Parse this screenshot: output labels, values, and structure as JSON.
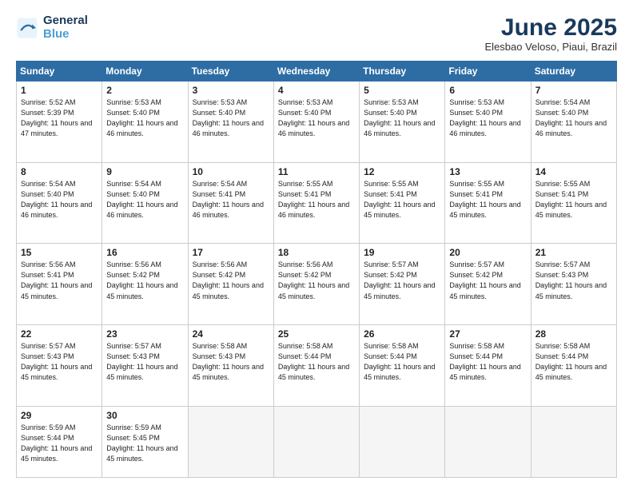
{
  "logo": {
    "line1": "General",
    "line2": "Blue"
  },
  "title": "June 2025",
  "subtitle": "Elesbao Veloso, Piaui, Brazil",
  "days_header": [
    "Sunday",
    "Monday",
    "Tuesday",
    "Wednesday",
    "Thursday",
    "Friday",
    "Saturday"
  ],
  "weeks": [
    [
      {
        "num": "1",
        "rise": "5:52 AM",
        "set": "5:39 PM",
        "hours": "11 hours and 47 minutes."
      },
      {
        "num": "2",
        "rise": "5:53 AM",
        "set": "5:40 PM",
        "hours": "11 hours and 46 minutes."
      },
      {
        "num": "3",
        "rise": "5:53 AM",
        "set": "5:40 PM",
        "hours": "11 hours and 46 minutes."
      },
      {
        "num": "4",
        "rise": "5:53 AM",
        "set": "5:40 PM",
        "hours": "11 hours and 46 minutes."
      },
      {
        "num": "5",
        "rise": "5:53 AM",
        "set": "5:40 PM",
        "hours": "11 hours and 46 minutes."
      },
      {
        "num": "6",
        "rise": "5:53 AM",
        "set": "5:40 PM",
        "hours": "11 hours and 46 minutes."
      },
      {
        "num": "7",
        "rise": "5:54 AM",
        "set": "5:40 PM",
        "hours": "11 hours and 46 minutes."
      }
    ],
    [
      {
        "num": "8",
        "rise": "5:54 AM",
        "set": "5:40 PM",
        "hours": "11 hours and 46 minutes."
      },
      {
        "num": "9",
        "rise": "5:54 AM",
        "set": "5:40 PM",
        "hours": "11 hours and 46 minutes."
      },
      {
        "num": "10",
        "rise": "5:54 AM",
        "set": "5:41 PM",
        "hours": "11 hours and 46 minutes."
      },
      {
        "num": "11",
        "rise": "5:55 AM",
        "set": "5:41 PM",
        "hours": "11 hours and 46 minutes."
      },
      {
        "num": "12",
        "rise": "5:55 AM",
        "set": "5:41 PM",
        "hours": "11 hours and 45 minutes."
      },
      {
        "num": "13",
        "rise": "5:55 AM",
        "set": "5:41 PM",
        "hours": "11 hours and 45 minutes."
      },
      {
        "num": "14",
        "rise": "5:55 AM",
        "set": "5:41 PM",
        "hours": "11 hours and 45 minutes."
      }
    ],
    [
      {
        "num": "15",
        "rise": "5:56 AM",
        "set": "5:41 PM",
        "hours": "11 hours and 45 minutes."
      },
      {
        "num": "16",
        "rise": "5:56 AM",
        "set": "5:42 PM",
        "hours": "11 hours and 45 minutes."
      },
      {
        "num": "17",
        "rise": "5:56 AM",
        "set": "5:42 PM",
        "hours": "11 hours and 45 minutes."
      },
      {
        "num": "18",
        "rise": "5:56 AM",
        "set": "5:42 PM",
        "hours": "11 hours and 45 minutes."
      },
      {
        "num": "19",
        "rise": "5:57 AM",
        "set": "5:42 PM",
        "hours": "11 hours and 45 minutes."
      },
      {
        "num": "20",
        "rise": "5:57 AM",
        "set": "5:42 PM",
        "hours": "11 hours and 45 minutes."
      },
      {
        "num": "21",
        "rise": "5:57 AM",
        "set": "5:43 PM",
        "hours": "11 hours and 45 minutes."
      }
    ],
    [
      {
        "num": "22",
        "rise": "5:57 AM",
        "set": "5:43 PM",
        "hours": "11 hours and 45 minutes."
      },
      {
        "num": "23",
        "rise": "5:57 AM",
        "set": "5:43 PM",
        "hours": "11 hours and 45 minutes."
      },
      {
        "num": "24",
        "rise": "5:58 AM",
        "set": "5:43 PM",
        "hours": "11 hours and 45 minutes."
      },
      {
        "num": "25",
        "rise": "5:58 AM",
        "set": "5:44 PM",
        "hours": "11 hours and 45 minutes."
      },
      {
        "num": "26",
        "rise": "5:58 AM",
        "set": "5:44 PM",
        "hours": "11 hours and 45 minutes."
      },
      {
        "num": "27",
        "rise": "5:58 AM",
        "set": "5:44 PM",
        "hours": "11 hours and 45 minutes."
      },
      {
        "num": "28",
        "rise": "5:58 AM",
        "set": "5:44 PM",
        "hours": "11 hours and 45 minutes."
      }
    ],
    [
      {
        "num": "29",
        "rise": "5:59 AM",
        "set": "5:44 PM",
        "hours": "11 hours and 45 minutes."
      },
      {
        "num": "30",
        "rise": "5:59 AM",
        "set": "5:45 PM",
        "hours": "11 hours and 45 minutes."
      },
      null,
      null,
      null,
      null,
      null
    ]
  ]
}
